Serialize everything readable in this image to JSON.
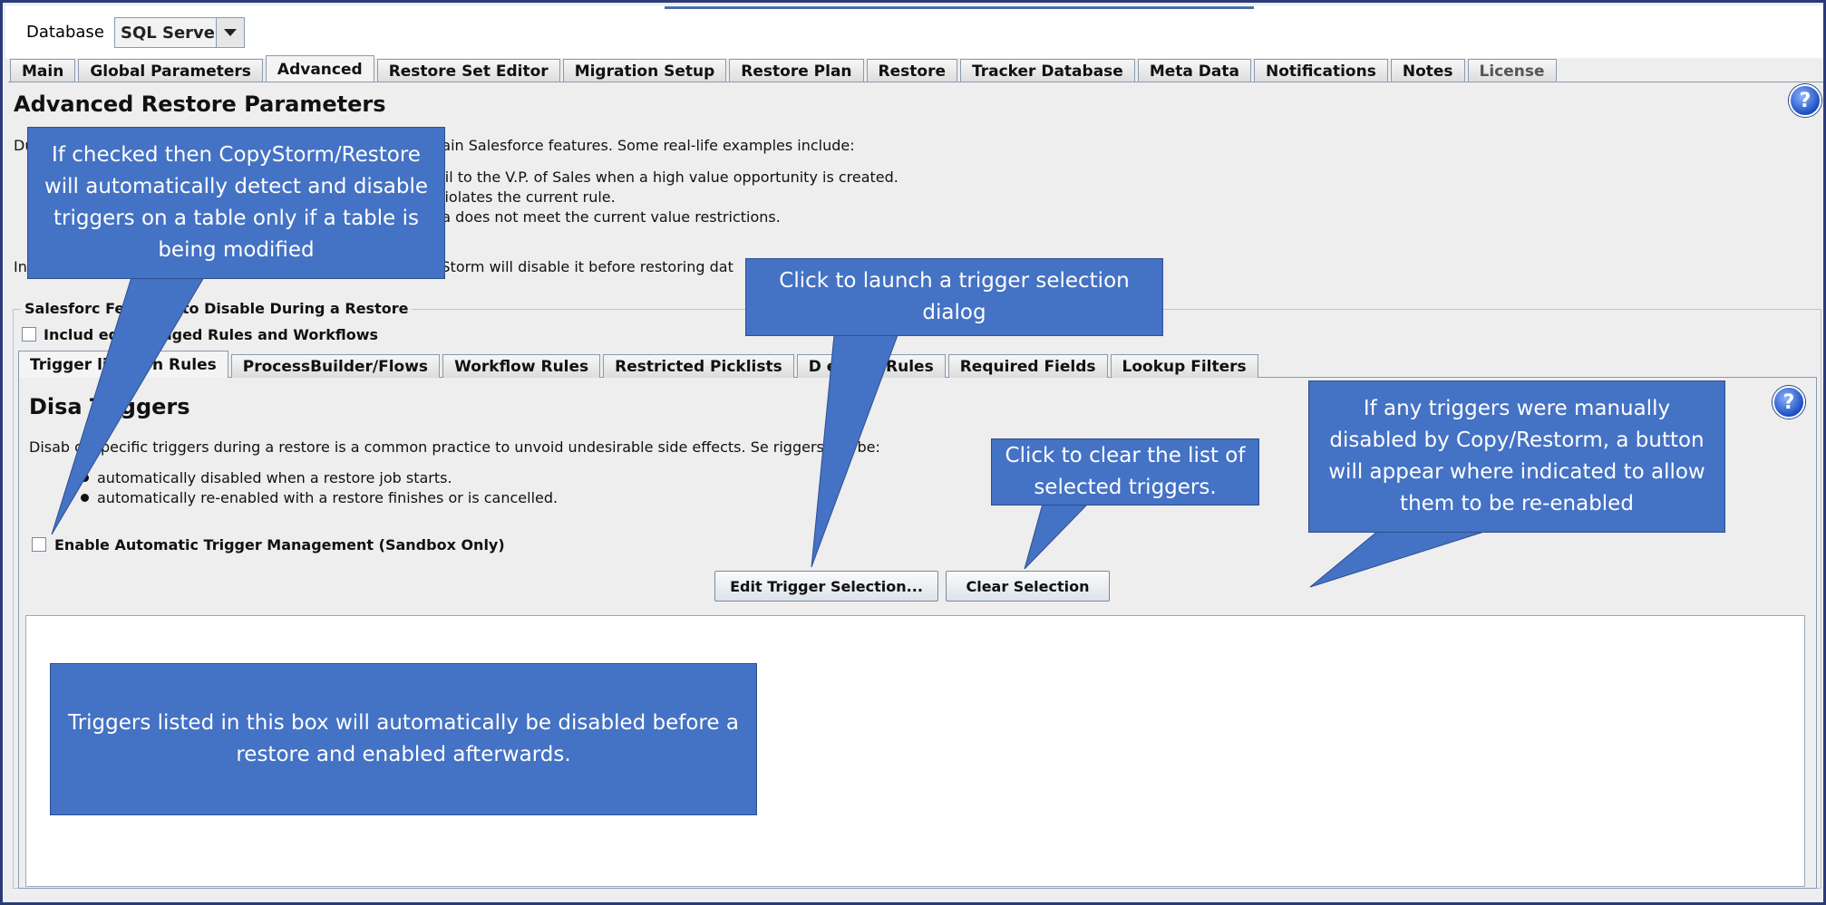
{
  "header": {
    "database_label": "Database",
    "database_value": "SQL Server"
  },
  "main_tabs": [
    {
      "label": "Main"
    },
    {
      "label": "Global Parameters"
    },
    {
      "label": "Advanced"
    },
    {
      "label": "Restore Set Editor"
    },
    {
      "label": "Migration Setup"
    },
    {
      "label": "Restore Plan"
    },
    {
      "label": "Restore"
    },
    {
      "label": "Tracker Database"
    },
    {
      "label": "Meta Data"
    },
    {
      "label": "Notifications"
    },
    {
      "label": "Notes"
    },
    {
      "label": "License"
    }
  ],
  "advanced": {
    "title": "Advanced Restore Parameters",
    "intro_start": "Du",
    "intro_end": "tain Salesforce features. Some real-life examples include:",
    "example1": "ail to the V.P. of Sales when a high value opportunity is created.",
    "example2": "violates the current rule.",
    "example3": "ta does not meet the current value restrictions.",
    "note_start": "In",
    "note_end": "/Storm will disable it before restoring dat",
    "fieldset_legend": "Salesforc                    Features to Disable During a Restore",
    "include_label": "Includ                ed Packaged Rules and Workflows"
  },
  "sub_tabs": [
    {
      "label": "Trigger      lidation Rules"
    },
    {
      "label": "ProcessBuilder/Flows"
    },
    {
      "label": "Workflow Rules"
    },
    {
      "label": "Restricted Picklists"
    },
    {
      "label": "D                 ection Rules"
    },
    {
      "label": "Required Fields"
    },
    {
      "label": "Lookup Filters"
    }
  ],
  "triggers": {
    "title": "Disa      Triggers",
    "desc": "Disab     of specific triggers during a restore is a common practice to unvoid undesirable side effects. Se        riggers will be:",
    "bullet1": "automatically disabled when a restore job starts.",
    "bullet2": "automatically re-enabled with a restore finishes or is cancelled.",
    "auto_label": "Enable Automatic Trigger Management (Sandbox Only)",
    "edit_button": "Edit Trigger Selection...",
    "clear_button": "Clear Selection"
  },
  "callouts": {
    "auto_detect": "If checked then CopyStorm/Restore will automatically detect and disable triggers on a table only if a table is being modified",
    "launch": "Click to launch a trigger selection dialog",
    "clear": "Click to clear the list of selected triggers.",
    "reenable": "If  any triggers were manually disabled by Copy/Restorm, a button will appear where indicated to allow them to be re-enabled",
    "list": "Triggers listed in this box will automatically be disabled before a restore and enabled afterwards."
  },
  "help_icon_text": "?",
  "colors": {
    "callout": "#4472c4",
    "frame_border": "#2b3b7a",
    "panel_bg": "#eeeeee"
  }
}
